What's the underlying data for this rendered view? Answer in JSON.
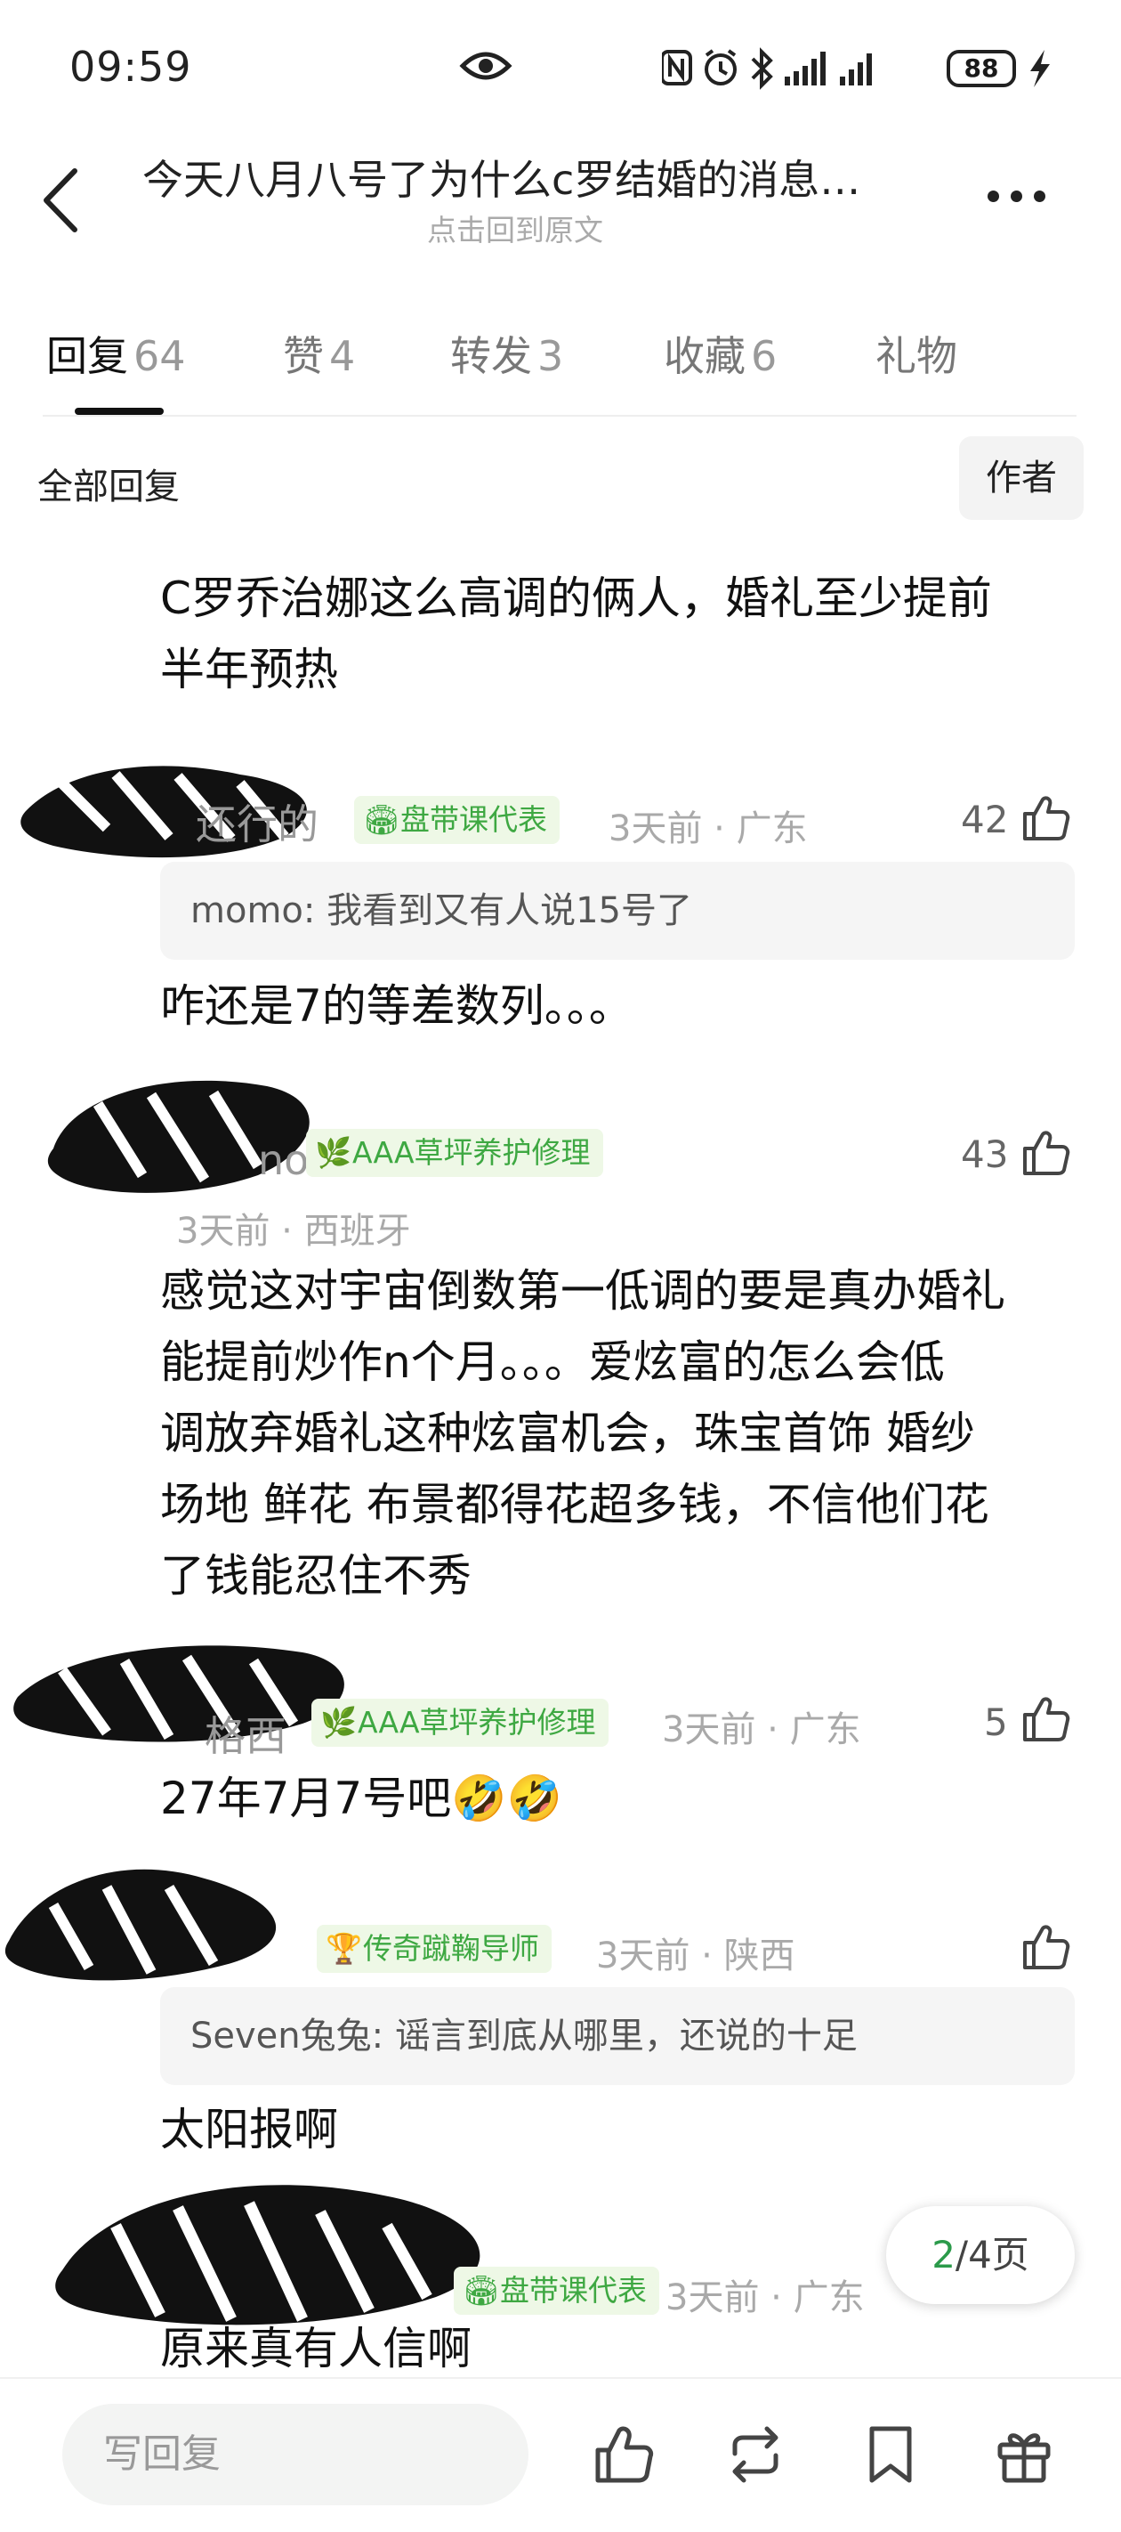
{
  "status_bar": {
    "time": "09:59",
    "battery": "88",
    "icons": [
      "eye-icon",
      "nfc-icon",
      "alarm-icon",
      "bluetooth-icon",
      "signal-icon",
      "signal-icon",
      "battery-icon",
      "charging-icon"
    ]
  },
  "header": {
    "title": "今天八月八号了为什么c罗结婚的消息…",
    "subtitle": "点击回到原文"
  },
  "tabs": [
    {
      "label": "回复",
      "count": "64",
      "active": true
    },
    {
      "label": "赞",
      "count": "4",
      "active": false
    },
    {
      "label": "转发",
      "count": "3",
      "active": false
    },
    {
      "label": "收藏",
      "count": "6",
      "active": false
    },
    {
      "label": "礼物",
      "count": "",
      "active": false
    }
  ],
  "filter": {
    "label": "全部回复",
    "author_button": "作者"
  },
  "comments": [
    {
      "text_lines": [
        "C罗乔治娜这么高调的俩人，婚礼至少提前",
        "半年预热"
      ]
    },
    {
      "name_fragment": "还行的",
      "badge": {
        "icon": "stadium-icon",
        "label": "盘带课代表"
      },
      "meta": "3天前 · 广东",
      "likes": "42",
      "quote": {
        "author": "momo",
        "text": ": 我看到又有人说15号了"
      },
      "text": "咋还是7的等差数列。。。"
    },
    {
      "name_fragment": "no",
      "badge": {
        "icon": "leaf-icon",
        "label": "AAA草坪养护修理"
      },
      "meta": "3天前 · 西班牙",
      "likes": "43",
      "text_lines": [
        "感觉这对宇宙倒数第一低调的要是真办婚礼",
        "能提前炒作n个月。。。爱炫富的怎么会低",
        "调放弃婚礼这种炫富机会，珠宝首饰 婚纱",
        "场地 鲜花 布景都得花超多钱，不信他们花",
        "了钱能忍住不秀"
      ]
    },
    {
      "name_fragment": "格西",
      "badge": {
        "icon": "leaf-icon",
        "label": "AAA草坪养护修理"
      },
      "meta": "3天前 · 广东",
      "likes": "5",
      "text": "27年7月7号吧🤣🤣"
    },
    {
      "name_fragment": "",
      "badge": {
        "icon": "trophy-icon",
        "label": "传奇蹴鞠导师"
      },
      "meta": "3天前 · 陕西",
      "likes": "",
      "quote": {
        "author": "Seven兔兔",
        "text": ": 谣言到底从哪里，还说的十足"
      },
      "text": "太阳报啊"
    },
    {
      "name_fragment": "",
      "badge": {
        "icon": "stadium-icon",
        "label": "盘带课代表"
      },
      "meta": "3天前 · 广东",
      "likes": "",
      "text": "原来真有人信啊"
    }
  ],
  "pagination": {
    "current": "2",
    "rest": "/4页"
  },
  "bottom_bar": {
    "reply_placeholder": "写回复",
    "icons": [
      "thumb-up-icon",
      "repost-icon",
      "bookmark-icon",
      "gift-icon"
    ]
  }
}
